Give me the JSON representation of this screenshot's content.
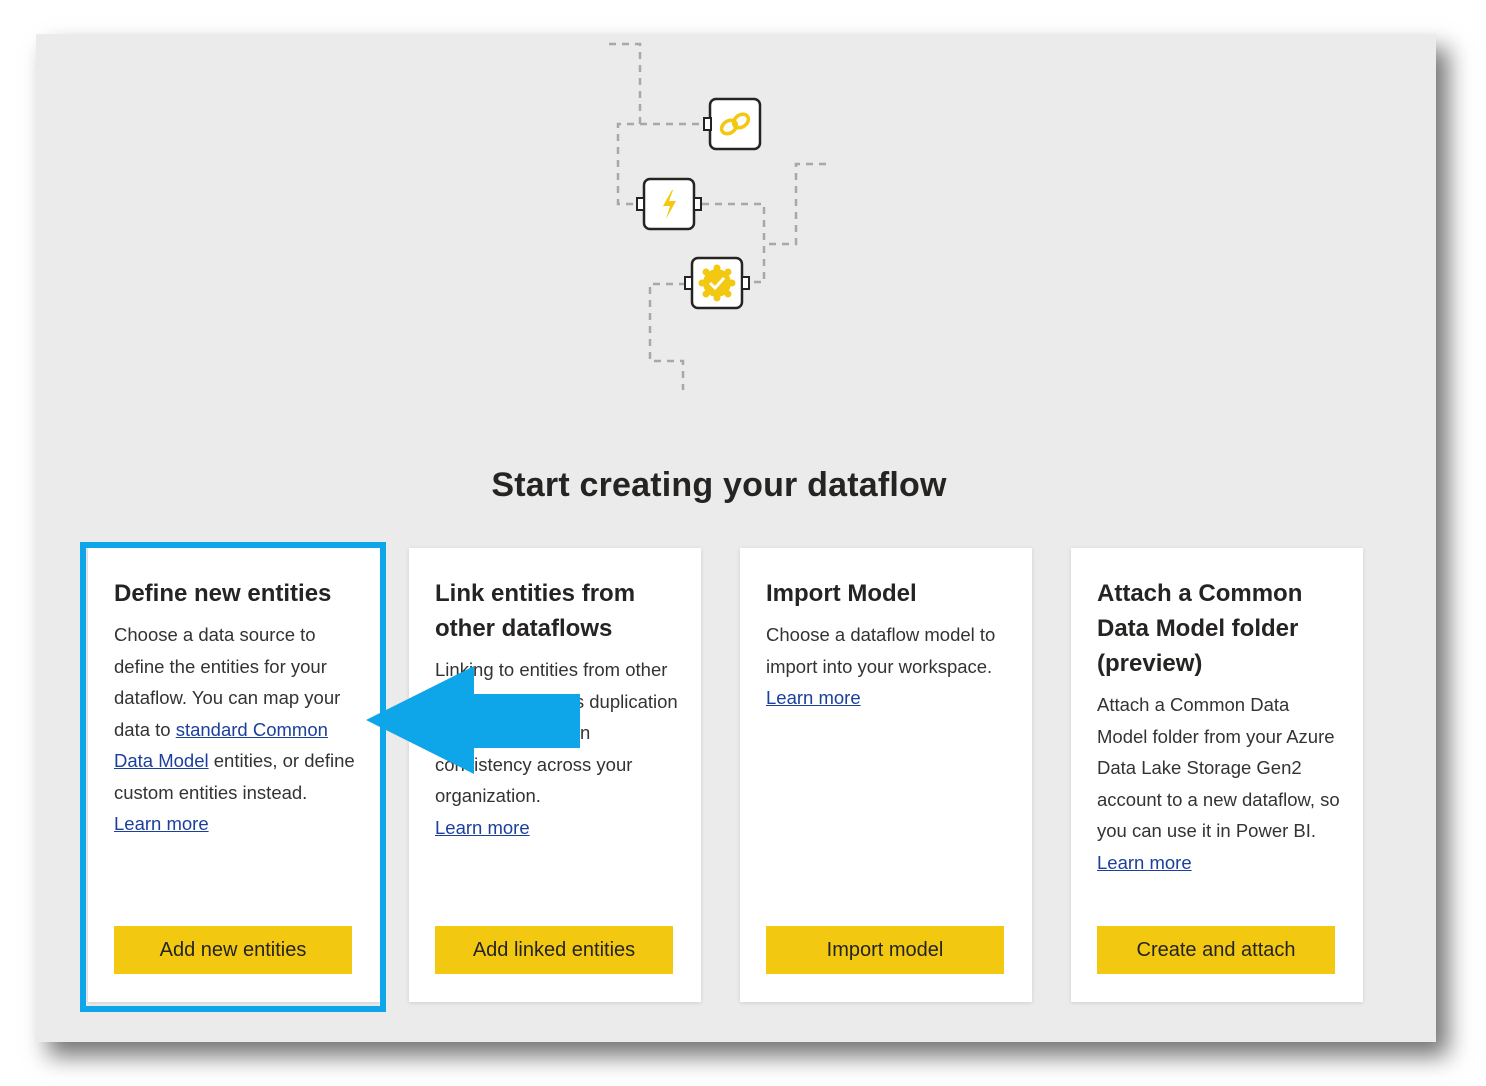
{
  "title": "Start creating your dataflow",
  "cards": [
    {
      "heading": "Define new entities",
      "description_before": "Choose a data source to define the entities for your dataflow. You can map your data to ",
      "description_link": "standard Common Data Model",
      "description_after": " entities, or define custom entities instead.",
      "learn_more": "Learn more",
      "button": "Add new entities"
    },
    {
      "heading": "Link entities from other dataflows",
      "description": "Linking to entities from other dataflows reduces duplication and helps maintain consistency across your organization.",
      "learn_more": "Learn more",
      "button": "Add linked entities"
    },
    {
      "heading": "Import Model",
      "description": "Choose a dataflow model to import into your workspace.",
      "learn_more": "Learn more",
      "button": "Import model"
    },
    {
      "heading": "Attach a Common Data Model folder (preview)",
      "description": "Attach a Common Data Model folder from your Azure Data Lake Storage Gen2 account to a new dataflow, so you can use it in Power BI.",
      "learn_more": "Learn more",
      "button": "Create and attach"
    }
  ],
  "colors": {
    "accent": "#f2c811",
    "highlight": "#0ea5e9",
    "link": "#1b3f9c",
    "background": "#ebebeb"
  },
  "icons": [
    "link-icon",
    "lightning-icon",
    "verified-badge-icon",
    "left-arrow-icon"
  ]
}
